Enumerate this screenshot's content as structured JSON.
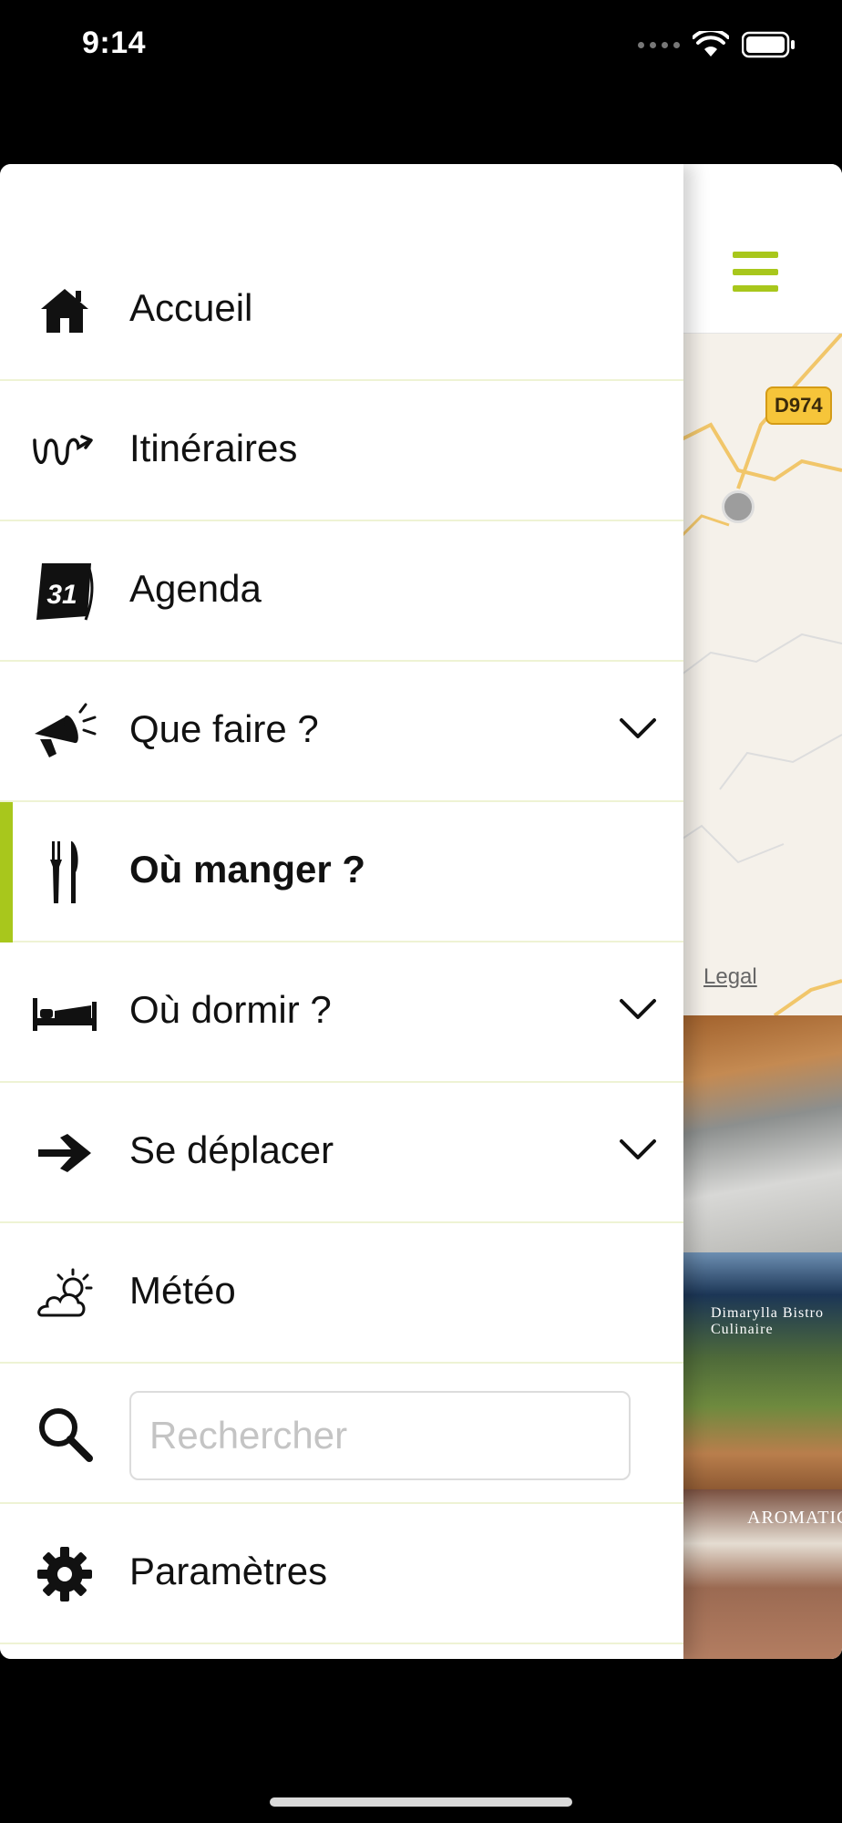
{
  "status_bar": {
    "time": "9:14"
  },
  "background_screen": {
    "map": {
      "road_label": "D974",
      "legal": "Legal"
    },
    "photos": [
      {
        "label": ""
      },
      {
        "label": "Dimarylla Bistro Culinaire"
      },
      {
        "label": "AROMATIC"
      },
      {
        "label": ""
      }
    ]
  },
  "menu": {
    "items": [
      {
        "label": "Accueil",
        "icon": "home-icon",
        "expandable": false,
        "active": false
      },
      {
        "label": "Itinéraires",
        "icon": "route-icon",
        "expandable": false,
        "active": false
      },
      {
        "label": "Agenda",
        "icon": "calendar-icon",
        "expandable": false,
        "active": false,
        "icon_text": "31"
      },
      {
        "label": "Que faire ?",
        "icon": "megaphone-icon",
        "expandable": true,
        "active": false
      },
      {
        "label": "Où manger ?",
        "icon": "cutlery-icon",
        "expandable": false,
        "active": true
      },
      {
        "label": "Où dormir ?",
        "icon": "bed-icon",
        "expandable": true,
        "active": false
      },
      {
        "label": "Se déplacer",
        "icon": "arrow-right-icon",
        "expandable": true,
        "active": false
      },
      {
        "label": "Météo",
        "icon": "weather-icon",
        "expandable": false,
        "active": false
      }
    ],
    "search": {
      "icon": "search-icon",
      "placeholder": "Rechercher",
      "value": ""
    },
    "settings": {
      "label": "Paramètres",
      "icon": "gear-icon"
    }
  },
  "colors": {
    "accent": "#a8c71c",
    "divider": "#eef3d4",
    "text": "#111111"
  }
}
